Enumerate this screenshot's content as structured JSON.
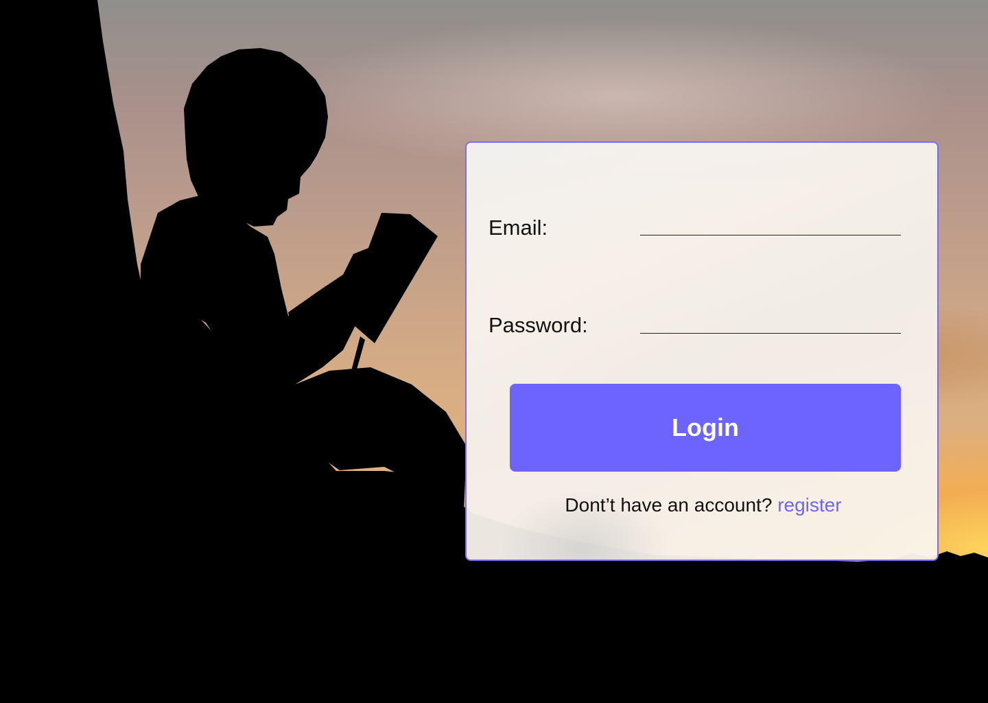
{
  "login_form": {
    "email_label": "Email:",
    "email_value": "",
    "password_label": "Password:",
    "password_value": "",
    "login_button_label": "Login",
    "register_prompt": "Dont’t have an account?",
    "register_link_label": "register"
  },
  "colors": {
    "accent": "#6d63fe",
    "card_border": "#7b6cf6",
    "text": "#111111"
  }
}
